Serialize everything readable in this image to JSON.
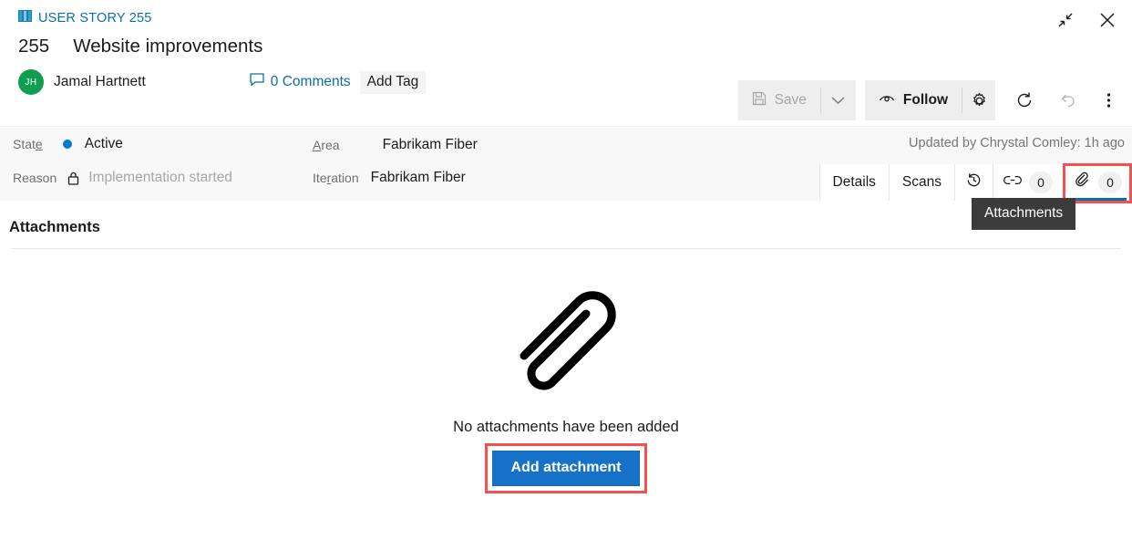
{
  "window": {
    "collapse_icon": "collapse-arrows-icon",
    "close_icon": "close-icon"
  },
  "header": {
    "work_item_type": "USER STORY 255",
    "type_icon": "user-story-book-icon",
    "id": "255",
    "title": "Website improvements",
    "assignee": {
      "initials": "JH",
      "name": "Jamal Hartnett",
      "avatar_color": "#0f9d4f"
    },
    "comments_label": "0 Comments",
    "comments_icon": "comment-bubble-icon",
    "add_tag_label": "Add Tag"
  },
  "toolbar": {
    "save_label": "Save",
    "save_icon": "save-floppy-icon",
    "save_disabled": true,
    "save_caret_icon": "chevron-down-icon",
    "follow_label": "Follow",
    "follow_icon": "eye-icon",
    "settings_icon": "gear-icon",
    "refresh_icon": "refresh-icon",
    "undo_icon": "undo-icon",
    "more_icon": "more-vertical-icon"
  },
  "fields": {
    "state_label": "State",
    "state_value": "Active",
    "state_color": "#007acc",
    "reason_label": "Reason",
    "reason_value": "Implementation started",
    "reason_icon": "lock-icon",
    "area_label": "Area",
    "area_value": "Fabrikam Fiber",
    "iteration_label": "Iteration",
    "iteration_value": "Fabrikam Fiber",
    "updated_by": "Updated by Chrystal Comley: 1h ago"
  },
  "tabs": [
    {
      "label": "Details",
      "icon": "",
      "count": "",
      "selected": false
    },
    {
      "label": "Scans",
      "icon": "",
      "count": "",
      "selected": false
    },
    {
      "label": "",
      "icon": "history-clock-icon",
      "count": "",
      "selected": false
    },
    {
      "label": "",
      "icon": "link-icon",
      "count": "0",
      "selected": false
    },
    {
      "label": "",
      "icon": "paperclip-icon",
      "count": "0",
      "selected": true
    }
  ],
  "tooltip": {
    "text": "Attachments"
  },
  "section": {
    "title": "Attachments"
  },
  "empty_state": {
    "icon": "paperclip-large-icon",
    "message": "No attachments have been added",
    "button_label": "Add attachment",
    "button_color": "#1572c8"
  },
  "annotations": {
    "highlight_color": "#f4514e"
  }
}
